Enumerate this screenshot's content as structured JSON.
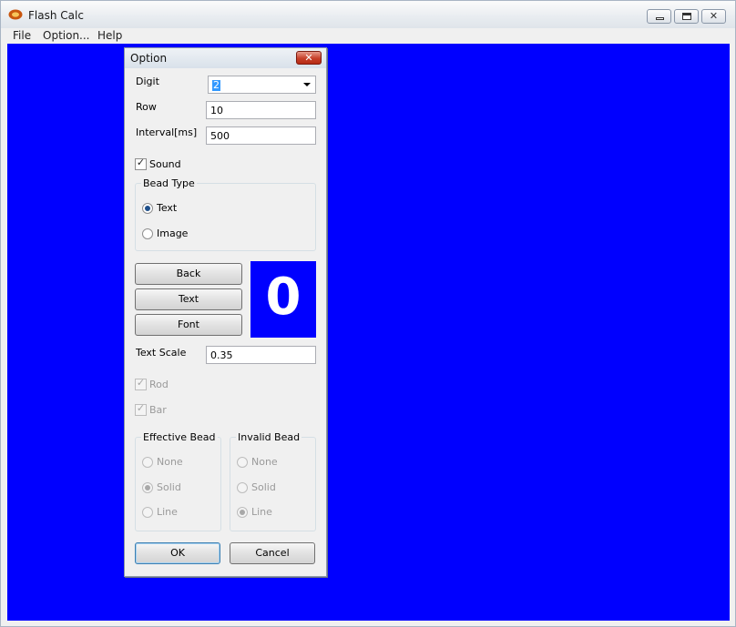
{
  "window": {
    "title": "Flash Calc",
    "menu": [
      "File",
      "Option...",
      "Help"
    ],
    "controls": {
      "minimize": "minimize-icon",
      "maximize": "maximize-icon",
      "close": "close-icon"
    },
    "canvas_color": "#0000ff"
  },
  "dialog": {
    "title": "Option",
    "close_glyph": "✕",
    "digit_label": "Digit",
    "digit_value": "2",
    "row_label": "Row",
    "row_value": "10",
    "interval_label": "Interval[ms]",
    "interval_value": "500",
    "sound_label": "Sound",
    "sound_checked": true,
    "bead_type": {
      "title": "Bead Type",
      "text_label": "Text",
      "image_label": "Image",
      "selected": "Text"
    },
    "buttons": {
      "back": "Back",
      "text": "Text",
      "font": "Font",
      "ok": "OK",
      "cancel": "Cancel"
    },
    "preview_char": "0",
    "text_scale_label": "Text Scale",
    "text_scale_value": "0.35",
    "rod_label": "Rod",
    "bar_label": "Bar",
    "effective_bead": {
      "title": "Effective Bead",
      "options": [
        "None",
        "Solid",
        "Line"
      ],
      "selected": "Solid"
    },
    "invalid_bead": {
      "title": "Invalid Bead",
      "options": [
        "None",
        "Solid",
        "Line"
      ],
      "selected": "Line"
    },
    "check_glyph": "✓"
  }
}
